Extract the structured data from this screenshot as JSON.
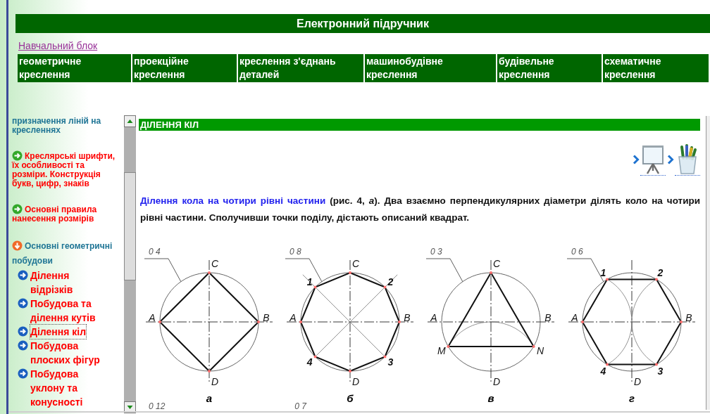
{
  "header": {
    "title": "Електронний підручник"
  },
  "breadcrumb_link": "Навчальний блок",
  "nav": [
    {
      "label": "геометричне креслення"
    },
    {
      "label": "проекційне креслення"
    },
    {
      "label": "креслення з'єднань деталей"
    },
    {
      "label": "машинобудівне креслення"
    },
    {
      "label": "будівельне креслення"
    },
    {
      "label": "схематичне креслення"
    }
  ],
  "sidebar": {
    "items": [
      {
        "kind": "text",
        "label": "призначення ліній на кресленнях"
      },
      {
        "kind": "section",
        "label": "Креслярські шрифти, їх особливості та розміри. Конструкція букв, цифр, знаків",
        "expanded": false
      },
      {
        "kind": "section",
        "label": "Основні правила нанесення розмірів",
        "expanded": false
      },
      {
        "kind": "section",
        "label": "Основні геометричні побудови",
        "expanded": true,
        "children": [
          {
            "label": "Ділення відрізків",
            "selected": false
          },
          {
            "label": "Побудова та ділення кутів",
            "selected": false
          },
          {
            "label": "Ділення кіл",
            "selected": true
          },
          {
            "label": "Побудова плоских фігур",
            "selected": false
          },
          {
            "label": "Побудова уклону та конусності",
            "selected": false
          }
        ]
      }
    ]
  },
  "content": {
    "heading": "ДІЛЕННЯ КІЛ",
    "paragraph": {
      "lead": "Ділення кола на чотири рівні частини",
      "text": " (рис. 4, *а*). Два взаємно перпендикулярних діаметри ділять коло на чотири рівні частини. Сполучивши точки поділу, дістають описаний квадрат."
    },
    "figures": [
      {
        "kind": "square",
        "size_mark": "0 4",
        "points": [
          "A",
          "C",
          "B",
          "D"
        ],
        "caption": "а"
      },
      {
        "kind": "octagon",
        "size_mark": "0 8",
        "points": [
          "A",
          "1",
          "C",
          "2",
          "B",
          "3",
          "D",
          "4"
        ],
        "caption": "б"
      },
      {
        "kind": "triangle",
        "size_mark": "0 3",
        "points": [
          "A",
          "C",
          "B",
          "M",
          "N",
          "D"
        ],
        "caption": "в"
      },
      {
        "kind": "hexagon",
        "size_mark": "0 6",
        "points": [
          "A",
          "1",
          "2",
          "B",
          "3",
          "4",
          "D"
        ],
        "caption": "г"
      }
    ],
    "next_row_marks": [
      "0 12",
      "0 7"
    ]
  }
}
